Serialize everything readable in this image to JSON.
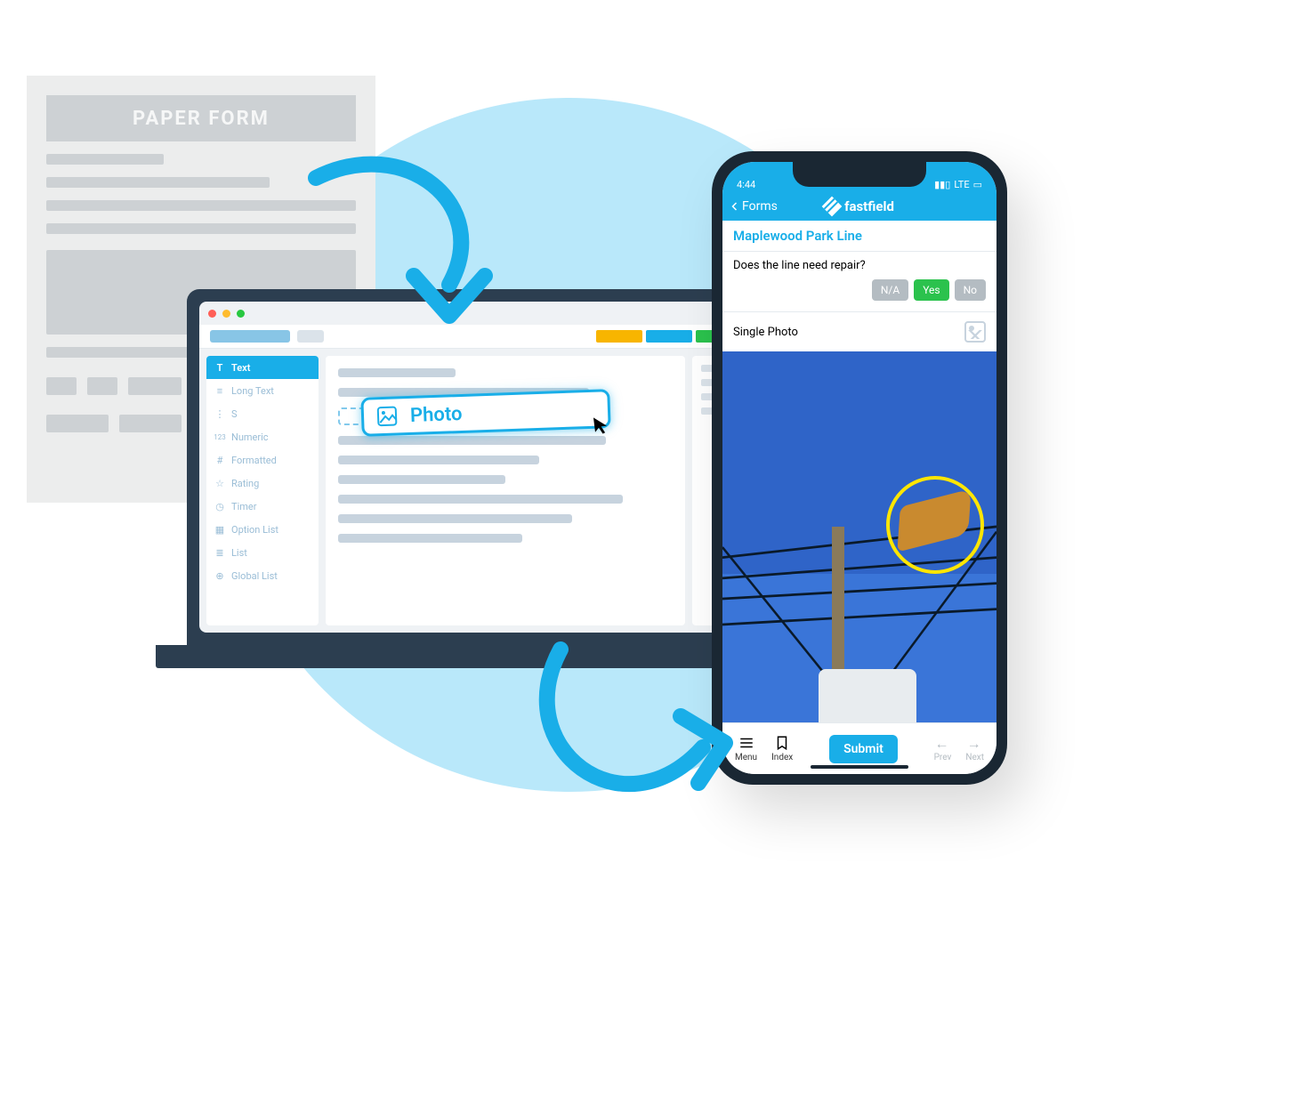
{
  "paper": {
    "title": "PAPER FORM"
  },
  "laptop": {
    "sidebar": [
      {
        "icon": "text-icon",
        "label": "Text",
        "active": true
      },
      {
        "icon": "longtext-icon",
        "label": "Long Text",
        "active": false
      },
      {
        "icon": "short-icon",
        "label": "S",
        "active": false
      },
      {
        "icon": "numeric-icon",
        "label": "Numeric",
        "active": false
      },
      {
        "icon": "formatted-icon",
        "label": "Formatted",
        "active": false
      },
      {
        "icon": "rating-icon",
        "label": "Rating",
        "active": false
      },
      {
        "icon": "timer-icon",
        "label": "Timer",
        "active": false
      },
      {
        "icon": "option-icon",
        "label": "Option List",
        "active": false
      },
      {
        "icon": "list-icon",
        "label": "List",
        "active": false
      },
      {
        "icon": "global-icon",
        "label": "Global List",
        "active": false
      }
    ],
    "drag_chip": "Photo"
  },
  "phone": {
    "status": {
      "time": "4:44",
      "network": "LTE"
    },
    "back_label": "Forms",
    "brand": "fastfield",
    "form_title": "Maplewood Park Line",
    "question": "Does the line need repair?",
    "answers": {
      "na": "N/A",
      "yes": "Yes",
      "no": "No"
    },
    "photo_field_label": "Single Photo",
    "submit": "Submit",
    "nav": {
      "menu": "Menu",
      "index": "Index",
      "prev": "Prev",
      "next": "Next"
    }
  }
}
